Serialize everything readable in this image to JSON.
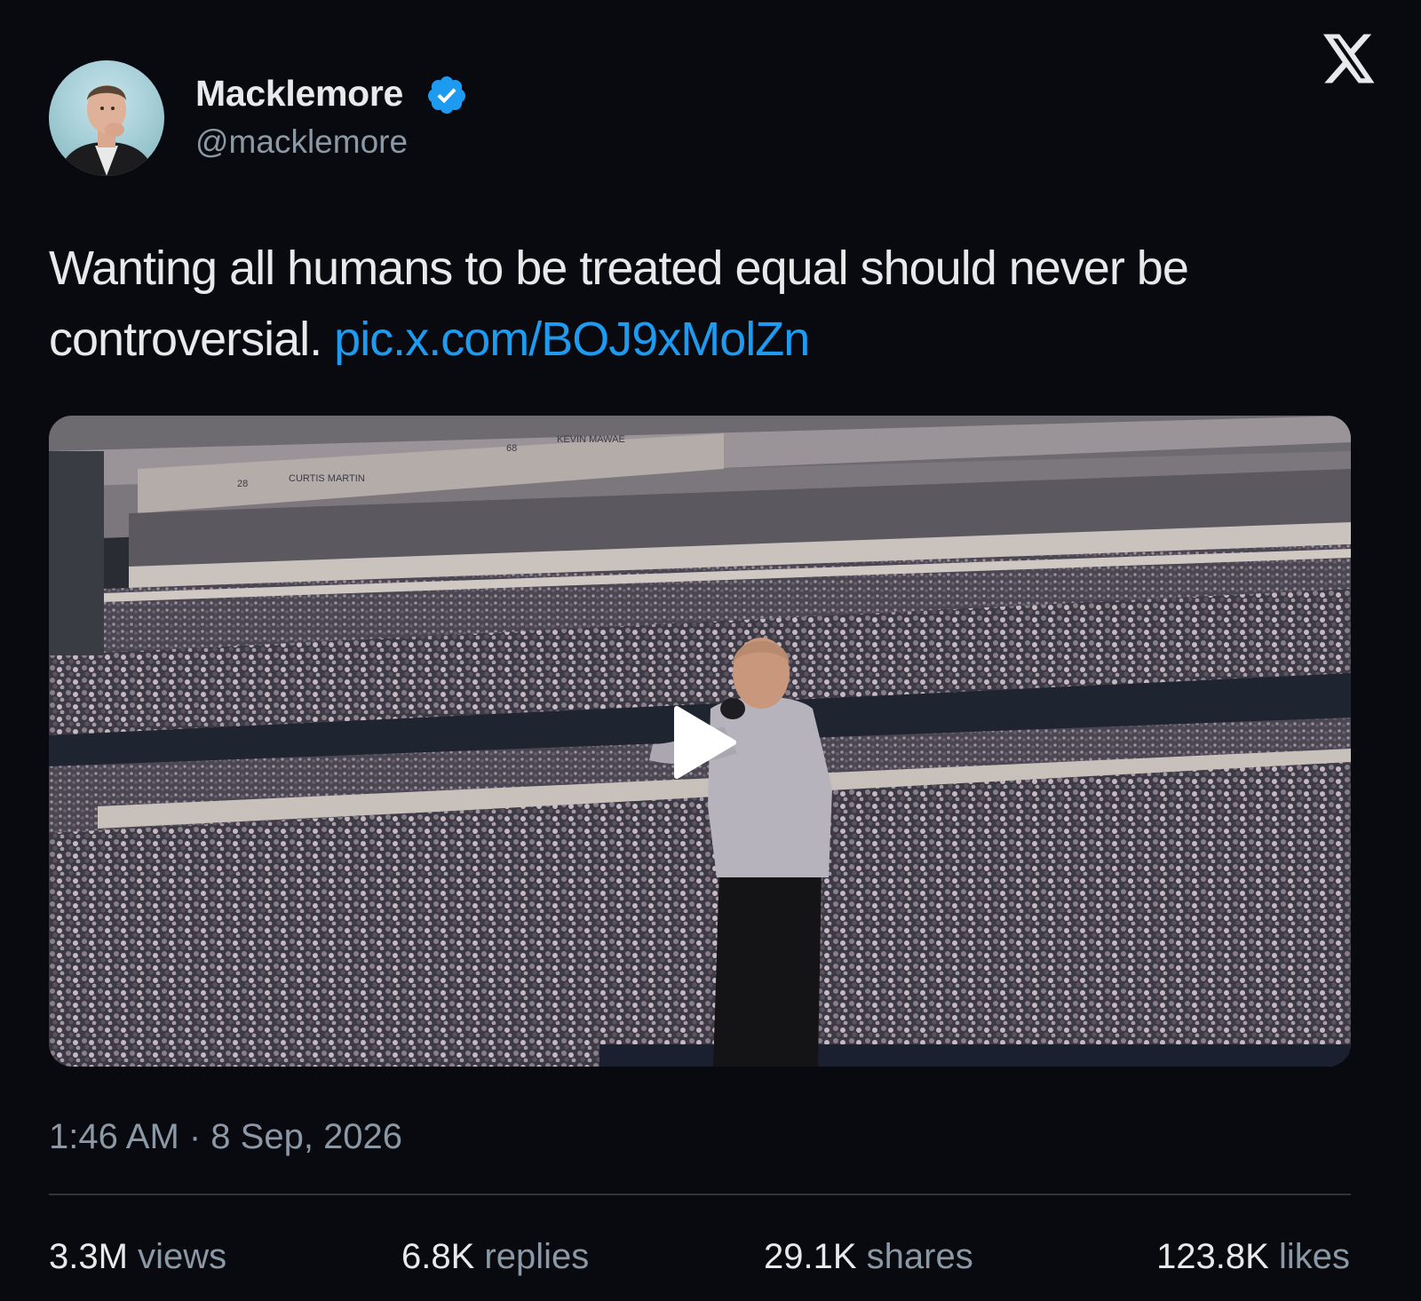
{
  "author": {
    "name": "Macklemore",
    "handle": "@macklemore",
    "verified": true
  },
  "tweet": {
    "text": "Wanting all humans to be treated equal should never be controversial.",
    "link": "pic.x.com/BOJ9xMolZn"
  },
  "media": {
    "type": "video",
    "stadium_signs": [
      "28",
      "CURTIS MARTIN",
      "68",
      "KEVIN MAWAE"
    ]
  },
  "timestamp": "1:46 AM · 8 Sep, 2026",
  "stats": {
    "views": {
      "count": "3.3M",
      "label": "views"
    },
    "replies": {
      "count": "6.8K",
      "label": "replies"
    },
    "shares": {
      "count": "29.1K",
      "label": "shares"
    },
    "likes": {
      "count": "123.8K",
      "label": "likes"
    }
  },
  "colors": {
    "background": "#090a0f",
    "link": "#1d9bf0",
    "verified": "#1d9bf0",
    "secondary_text": "#8b98a5"
  },
  "icons": {
    "platform_logo": "x-logo-icon",
    "verified": "verified-badge-icon",
    "play": "play-icon"
  }
}
